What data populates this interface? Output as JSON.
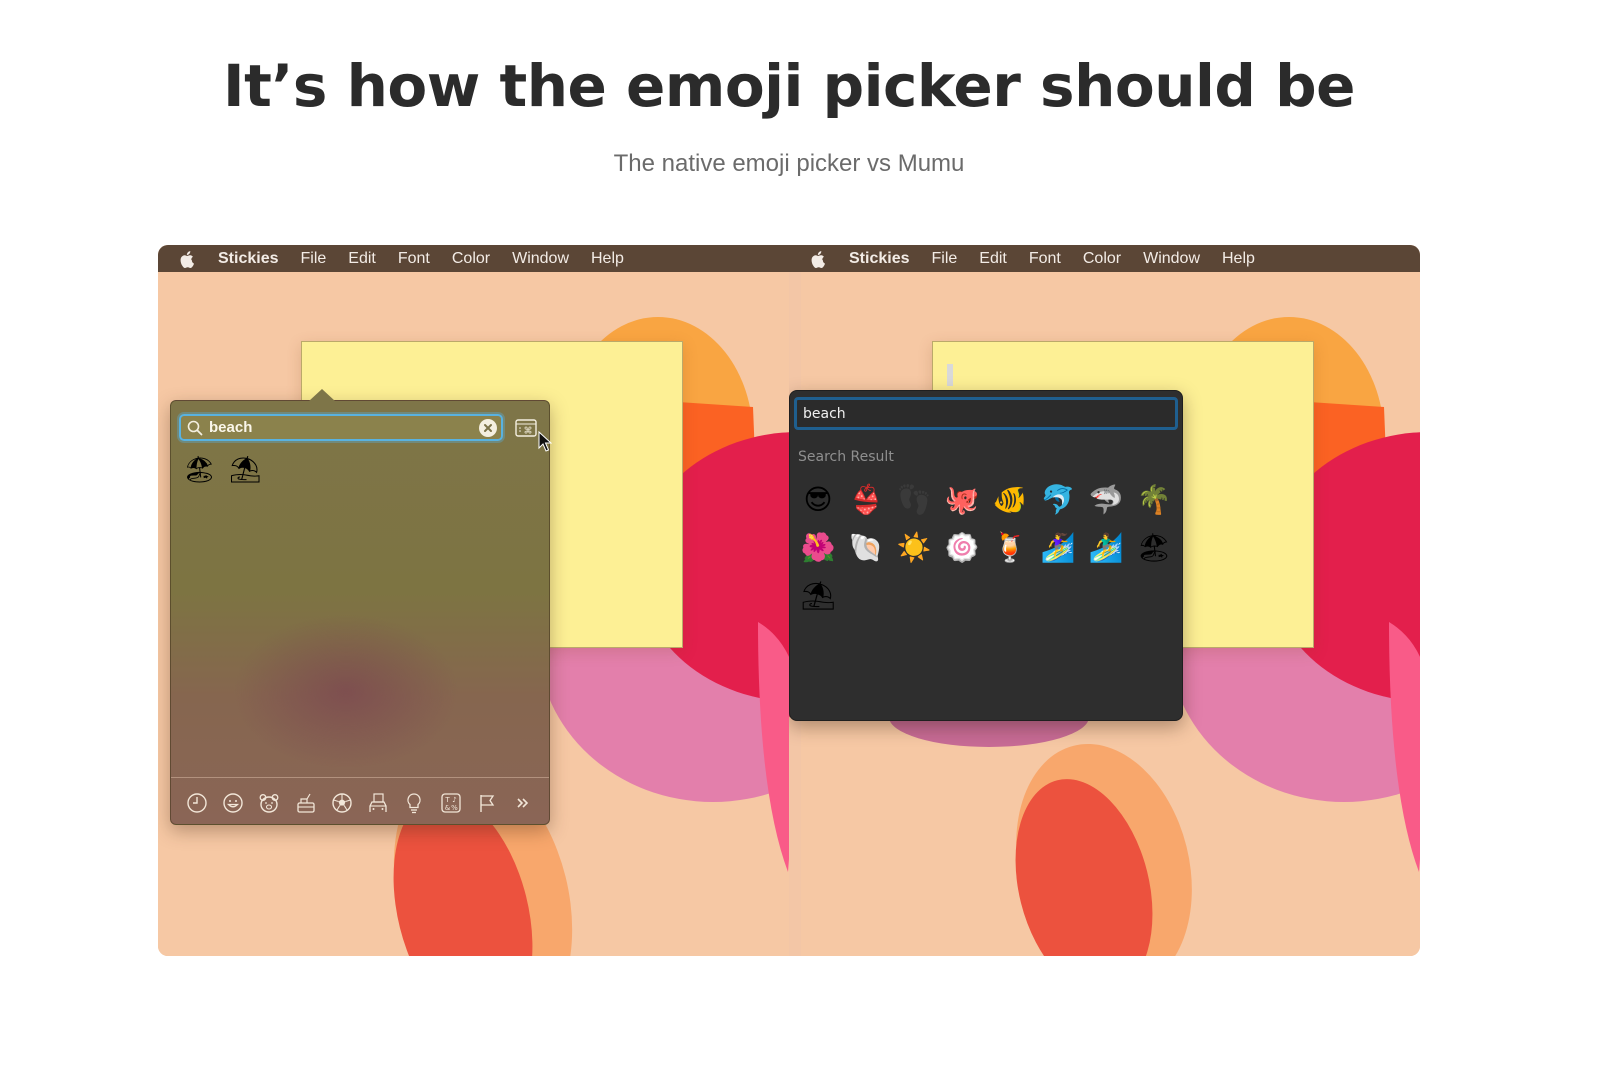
{
  "page": {
    "headline": "It’s how the emoji picker should be",
    "subheadline": "The native emoji picker vs Mumu"
  },
  "menubar": {
    "app_name": "Stickies",
    "items": [
      "File",
      "Edit",
      "Font",
      "Color",
      "Window",
      "Help"
    ]
  },
  "native_picker": {
    "search_value": "beach",
    "results": [
      {
        "name": "beach-with-umbrella",
        "glyph": "🏖"
      },
      {
        "name": "umbrella-on-ground",
        "glyph": "⛱"
      }
    ],
    "categories": [
      {
        "name": "recent",
        "icon": "clock-icon"
      },
      {
        "name": "smileys",
        "icon": "smiley-icon"
      },
      {
        "name": "animals",
        "icon": "bear-icon"
      },
      {
        "name": "food",
        "icon": "food-icon"
      },
      {
        "name": "activity",
        "icon": "soccer-ball-icon"
      },
      {
        "name": "travel",
        "icon": "car-building-icon"
      },
      {
        "name": "objects",
        "icon": "lightbulb-icon"
      },
      {
        "name": "symbols",
        "icon": "symbols-icon"
      },
      {
        "name": "flags",
        "icon": "flag-icon"
      },
      {
        "name": "more",
        "icon": "double-chevron-right-icon"
      }
    ]
  },
  "mumu_picker": {
    "search_value": "beach",
    "section_label": "Search Result",
    "results": [
      {
        "name": "smiling-face-with-sunglasses",
        "glyph": "😎"
      },
      {
        "name": "bikini",
        "glyph": "👙"
      },
      {
        "name": "footprints",
        "glyph": "👣",
        "dim": true
      },
      {
        "name": "octopus",
        "glyph": "🐙"
      },
      {
        "name": "tropical-fish",
        "glyph": "🐠"
      },
      {
        "name": "dolphin",
        "glyph": "🐬"
      },
      {
        "name": "shark",
        "glyph": "🦈"
      },
      {
        "name": "palm-tree",
        "glyph": "🌴"
      },
      {
        "name": "hibiscus",
        "glyph": "🌺"
      },
      {
        "name": "spiral-shell",
        "glyph": "🐚"
      },
      {
        "name": "sun",
        "glyph": "☀️"
      },
      {
        "name": "fish-cake",
        "glyph": "🍥"
      },
      {
        "name": "tropical-drink",
        "glyph": "🍹"
      },
      {
        "name": "woman-surfing",
        "glyph": "🏄‍♀️"
      },
      {
        "name": "man-surfing",
        "glyph": "🏄‍♂️"
      },
      {
        "name": "beach-with-umbrella",
        "glyph": "🏖"
      },
      {
        "name": "umbrella-on-ground",
        "glyph": "⛱"
      }
    ]
  },
  "colors": {
    "menubar_bg": "#5b4636",
    "wallpaper_bg": "#f6c8a4",
    "sticky_note": "#fdf095",
    "native_focus_ring": "#59b2e0",
    "mumu_bg": "#2e2e2e",
    "mumu_focus_ring": "#1f5f8f"
  }
}
